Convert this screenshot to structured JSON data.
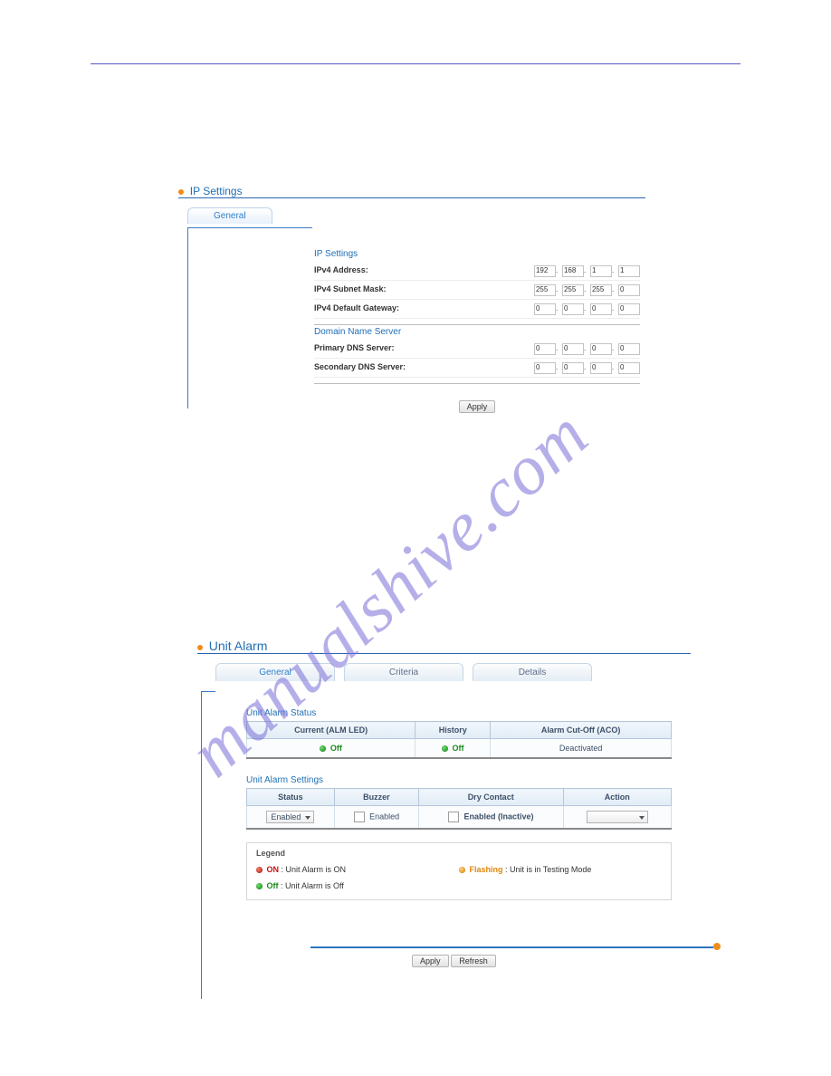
{
  "watermark": "manualshive.com",
  "ip": {
    "title": "IP Settings",
    "tab": "General",
    "section_ip": "IP Settings",
    "rows": {
      "addr": {
        "label": "IPv4 Address:",
        "oct": [
          "192",
          "168",
          "1",
          "1"
        ]
      },
      "mask": {
        "label": "IPv4 Subnet Mask:",
        "oct": [
          "255",
          "255",
          "255",
          "0"
        ]
      },
      "gw": {
        "label": "IPv4 Default Gateway:",
        "oct": [
          "0",
          "0",
          "0",
          "0"
        ]
      }
    },
    "section_dns": "Domain Name Server",
    "dns": {
      "primary": {
        "label": "Primary DNS Server:",
        "oct": [
          "0",
          "0",
          "0",
          "0"
        ]
      },
      "secondary": {
        "label": "Secondary DNS Server:",
        "oct": [
          "0",
          "0",
          "0",
          "0"
        ]
      }
    },
    "apply": "Apply"
  },
  "ua": {
    "title": "Unit Alarm",
    "tabs": {
      "general": "General",
      "criteria": "Criteria",
      "details": "Details"
    },
    "status": {
      "head": "Unit Alarm Status",
      "cols": {
        "current": "Current (ALM LED)",
        "history": "History",
        "aco": "Alarm Cut-Off (ACO)"
      },
      "vals": {
        "current": "Off",
        "history": "Off",
        "aco": "Deactivated"
      }
    },
    "settings": {
      "head": "Unit Alarm Settings",
      "cols": {
        "status": "Status",
        "buzzer": "Buzzer",
        "dry": "Dry Contact",
        "action": "Action"
      },
      "vals": {
        "status": "Enabled",
        "buzzer": "Enabled",
        "dry": "Enabled (Inactive)"
      }
    },
    "legend": {
      "title": "Legend",
      "on": "ON",
      "on_desc": ": Unit Alarm is ON",
      "off": "Off",
      "off_desc": ": Unit Alarm is Off",
      "flashing": "Flashing",
      "flashing_desc": ": Unit is in Testing Mode"
    },
    "footer": {
      "apply": "Apply",
      "refresh": "Refresh"
    }
  }
}
